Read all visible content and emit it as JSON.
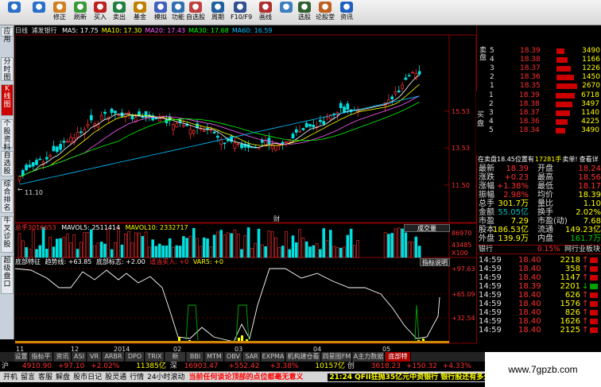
{
  "toolbar": {
    "buttons": [
      {
        "label": "",
        "icon": "back-icon",
        "color": "#2a6fc8"
      },
      {
        "label": "",
        "icon": "forward-icon",
        "color": "#2a6fc8"
      },
      {
        "label": "修正",
        "icon": "home-icon",
        "color": "#d08020"
      },
      {
        "label": "刷新",
        "icon": "refresh-icon",
        "color": "#3a9a3a"
      },
      {
        "label": "买入",
        "icon": "buy-icon",
        "color": "#c02020"
      },
      {
        "label": "卖出",
        "icon": "sell-icon",
        "color": "#208040"
      },
      {
        "label": "基金",
        "icon": "fund-icon",
        "color": "#c08000"
      },
      {
        "label": "模拟",
        "icon": "simulate-icon",
        "color": "#4060c0"
      },
      {
        "label": "功能",
        "icon": "function-icon",
        "color": "#3070b0"
      },
      {
        "label": "自选股",
        "icon": "favorites-icon",
        "color": "#c04040"
      },
      {
        "label": "周期",
        "icon": "period-icon",
        "color": "#2060a0"
      },
      {
        "label": "F10/F9",
        "icon": "f10-icon",
        "color": "#305090"
      },
      {
        "label": "画线",
        "icon": "drawline-icon",
        "color": "#b03030"
      },
      {
        "label": "",
        "icon": "zoom-icon",
        "color": "#4080c0"
      },
      {
        "label": "选股",
        "icon": "stockpick-icon",
        "color": "#306030"
      },
      {
        "label": "论股堂",
        "icon": "forum-icon",
        "color": "#c06020"
      },
      {
        "label": "资讯",
        "icon": "news-icon",
        "color": "#2060c0"
      }
    ]
  },
  "leftnav": [
    {
      "label": "应用"
    },
    {
      "label": "分时图"
    },
    {
      "label": "K线图",
      "active": true
    },
    {
      "label": "个股资料"
    },
    {
      "label": "自选股"
    },
    {
      "label": "综合排名"
    },
    {
      "label": "牛叉诊股"
    },
    {
      "label": "超级盘口"
    }
  ],
  "kline": {
    "period": "日线",
    "name": "浦发银行",
    "ma": [
      {
        "label": "MA5: 17.75",
        "color": "#ffffff"
      },
      {
        "label": "MA10: 17.30",
        "color": "#ffff00"
      },
      {
        "label": "MA20: 17.43",
        "color": "#ff60ff"
      },
      {
        "label": "MA30: 17.68",
        "color": "#00ff00"
      },
      {
        "label": "MA60: 16.59",
        "color": "#00c0ff"
      }
    ],
    "price_ticks": [
      "15.53",
      "13.53",
      "11.50"
    ],
    "low_label": "11.10",
    "mark": "财"
  },
  "volume": {
    "label": "总手",
    "total": "3016653",
    "mavol5": "MAVOL5: 2511414",
    "mavol10": "MAVOL10: 2332717",
    "button": "成交量",
    "ticks": [
      "86970",
      "43485",
      "X100"
    ]
  },
  "indicator": {
    "name": "底部特征",
    "trend": "趋势线: +63.85",
    "bottom": "底部标志: +2.00",
    "extra": "适当买入: +0",
    "var5": "VAR5: +0",
    "hint": "指标说明",
    "ticks": [
      "+97.63",
      "+65.09",
      "+32.54"
    ]
  },
  "xaxis": [
    "11",
    "12",
    "2014",
    "02",
    "03",
    "04",
    "05"
  ],
  "orderbook": {
    "sell_label": "卖盘",
    "buy_label": "买盘",
    "sell": [
      {
        "n": "5",
        "price": "18.39",
        "vol": "3490"
      },
      {
        "n": "4",
        "price": "18.38",
        "vol": "1166"
      },
      {
        "n": "3",
        "price": "18.37",
        "vol": "1226"
      },
      {
        "n": "2",
        "price": "18.36",
        "vol": "1450"
      },
      {
        "n": "1",
        "price": "18.35",
        "vol": "2670"
      }
    ],
    "buy": [
      {
        "n": "1",
        "price": "18.39",
        "vol": "6718"
      },
      {
        "n": "2",
        "price": "18.38",
        "vol": "3497"
      },
      {
        "n": "3",
        "price": "18.37",
        "vol": "1140"
      },
      {
        "n": "4",
        "price": "18.36",
        "vol": "4225"
      },
      {
        "n": "5",
        "price": "18.34",
        "vol": "3490"
      }
    ]
  },
  "info": {
    "pos_text": "在卖盘18.45位置有",
    "pos_vol": "17281手",
    "pos_tail": "卖单!",
    "look": "查看详",
    "rows": [
      [
        "最新",
        "18.39",
        "开盘",
        "18.24"
      ],
      [
        "涨跌",
        "+0.23",
        "最高",
        "18.56"
      ],
      [
        "涨幅",
        "+1.38%",
        "最低",
        "18.17"
      ],
      [
        "振幅",
        "2.98%",
        "均价",
        "18.39"
      ],
      [
        "总手",
        "301.7万",
        "量比",
        "1.10"
      ],
      [
        "金额",
        "55.05亿",
        "换手",
        "2.02%"
      ],
      [
        "市盈",
        "7.29",
        "市盈(动)",
        "7.68"
      ],
      [
        "股本",
        "186.53亿",
        "流通",
        "149.23亿"
      ],
      [
        "外盘",
        "139.9万",
        "内盘",
        "161.7万"
      ]
    ],
    "sector": "银行",
    "sector_pct": "0.15%",
    "sector_link": "网行业板块"
  },
  "ticks": [
    {
      "t": "14:59",
      "p": "18.40",
      "v": "2218"
    },
    {
      "t": "14:59",
      "p": "18.40",
      "v": "358"
    },
    {
      "t": "14:59",
      "p": "18.40",
      "v": "1147"
    },
    {
      "t": "14:59",
      "p": "18.39",
      "v": "2201"
    },
    {
      "t": "14:59",
      "p": "18.40",
      "v": "626"
    },
    {
      "t": "14:59",
      "p": "18.40",
      "v": "1576"
    },
    {
      "t": "14:59",
      "p": "18.40",
      "v": "826"
    },
    {
      "t": "14:59",
      "p": "18.40",
      "v": "1626"
    },
    {
      "t": "14:59",
      "p": "18.40",
      "v": "2125"
    }
  ],
  "tabs": [
    "设置",
    "指标平台",
    "资讯",
    "ASI",
    "VR",
    "ARBR",
    "DPO",
    "TRIX",
    "新DMA",
    "BBI",
    "MTM",
    "OBV",
    "SAR",
    "EXPMA",
    "机构建仓看盘",
    "四星图FM",
    "A主力数据",
    "底部特征"
  ],
  "index_bar": {
    "sh_label": "沪",
    "sh": "4910.90",
    "sh_chg": "+97.10",
    "sh_pct": "+2.02%",
    "sh_amt": "11385亿",
    "sz_label": "深",
    "sz": "16903.47",
    "sz_chg": "+552.42",
    "sz_pct": "+3.38%",
    "sz_amt": "10157亿",
    "cy_label": "创",
    "cy": "3618.23",
    "cy_chg": "+150.32",
    "cy_pct": "+4.33%"
  },
  "bottom_bar": {
    "items": [
      "开机",
      "留言",
      "客服",
      "解盘",
      "股市日记",
      "股灵通",
      "行情",
      "24小时滚动"
    ],
    "news1": "当前任何谈论顶部的点位都毫无意义",
    "news2": "21:24 QFII狂抛35亿元中资银行 银行股还有多少机会?"
  },
  "watermark": "www.7gpzb.com"
}
